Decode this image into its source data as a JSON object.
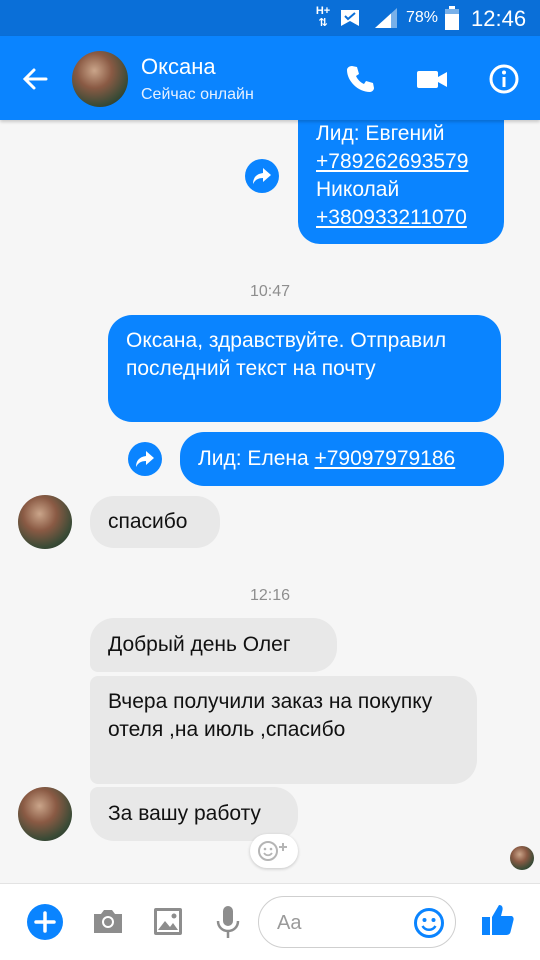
{
  "status_bar": {
    "network": "H+",
    "battery": "78%",
    "time": "12:46"
  },
  "header": {
    "name": "Оксана",
    "status": "Сейчас онлайн"
  },
  "messages": {
    "m1_line1": "Лид: Евгений",
    "m1_phone1": "+789262693579",
    "m1_line3": "Николай",
    "m1_phone2": "+380933211070",
    "time1": "10:47",
    "m2": "Оксана, здравствуйте. Отправил последний текст на почту",
    "m3_label": "Лид: Елена ",
    "m3_phone": "+79097979186",
    "m4": "спасибо",
    "time2": "12:16",
    "m5": "Добрый день Олег",
    "m6": "Вчера получили заказ на покупку отеля ,на июль ,спасибо",
    "m7": "За вашу работу"
  },
  "composer": {
    "placeholder": "Aa"
  },
  "colors": {
    "accent": "#0a84ff",
    "status_bar": "#0a6fd8",
    "incoming_bubble": "#e8e8e8"
  },
  "icons": [
    "back-arrow-icon",
    "phone-icon",
    "video-camera-icon",
    "info-icon",
    "forward-icon",
    "add-reaction-icon",
    "plus-icon",
    "camera-icon",
    "gallery-icon",
    "microphone-icon",
    "emoji-icon",
    "like-icon"
  ]
}
